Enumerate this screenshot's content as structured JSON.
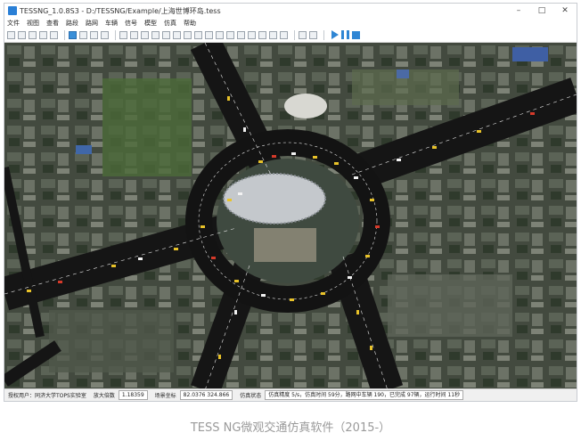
{
  "window": {
    "title": "TESSNG_1.0.8S3 - D:/TESSNG/Example/上海世博环岛.tess",
    "minimize_glyph": "–",
    "maximize_glyph": "□",
    "close_glyph": "✕"
  },
  "menu": [
    "文件",
    "视图",
    "查看",
    "路段",
    "路网",
    "车辆",
    "信号",
    "模型",
    "仿真",
    "帮助"
  ],
  "status": {
    "org": "授权用户：同济大学TOPS实验室",
    "scale_label": "放大倍数",
    "scale_value": "1.18359",
    "coord_label": "场景坐标",
    "coord_value": "82.0376 324.866",
    "run_label": "仿真状态",
    "run_info": "仿真精度 5/s，仿真时间 59分，路网中车辆 190，已完成 97辆，运行时间 11秒"
  },
  "caption": "TESS NG微观交通仿真软件（2015-）",
  "colors": {
    "accent": "#2f86d4",
    "road": "#151515",
    "lane_marking": "#e8e8e8",
    "vehicle_yellow": "#e8c229",
    "vehicle_red": "#d53a2a",
    "vehicle_white": "#f2f2f2"
  }
}
